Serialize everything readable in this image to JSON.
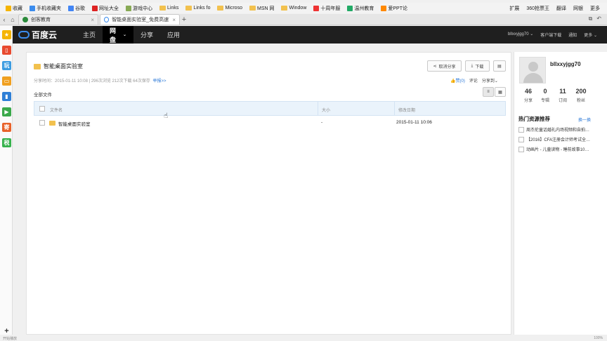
{
  "bookmarks": {
    "items": [
      "收藏",
      "手机收藏夹",
      "谷歌",
      "网址大全",
      "游戏中心",
      "Links",
      "Links fo",
      "Microso",
      "MSN 网",
      "Window",
      "十周年服",
      "温州教育",
      "爱PPT论"
    ],
    "right": [
      "扩展",
      "360抢票王",
      "翻译",
      "网银",
      "更多"
    ]
  },
  "tabs": [
    {
      "title": "创客教育"
    },
    {
      "title": "智能桌面实验室_免费高速下载"
    }
  ],
  "header": {
    "logo": "百度云",
    "nav": [
      "主页",
      "网盘",
      "分享",
      "应用"
    ],
    "user": "bllxxyjgg70",
    "links": [
      "客户端下载",
      "通知",
      "更多"
    ]
  },
  "share": {
    "title": "智能桌面实验室",
    "meta": "分享时间：2015-01-11 10:08 | 296次浏览 212次下载 64次保存",
    "report": "举报>>",
    "cancel_share": "取消分享",
    "download": "下载",
    "like": "赞(0)",
    "comment": "评论",
    "share_to": "分享到",
    "breadcrumb": "全部文件",
    "columns": {
      "name": "文件名",
      "size": "大小",
      "date": "修改日期"
    },
    "files": [
      {
        "name": "智能桌面实验室",
        "size": "-",
        "date": "2015-01-11 10:06"
      }
    ]
  },
  "profile": {
    "username": "bllxxyjgg70",
    "stats": [
      {
        "num": "46",
        "label": "分享"
      },
      {
        "num": "0",
        "label": "专辑"
      },
      {
        "num": "11",
        "label": "订阅"
      },
      {
        "num": "200",
        "label": "粉丝"
      }
    ],
    "hot_title": "热门资源推荐",
    "hot_more": "换一换",
    "hot_items": [
      "周杰伦童话婚礼内场视频和自拍…",
      "【2016】CFA注册会计师考试全…",
      "动画片 - 儿童读物 - 睡前故事10…"
    ]
  },
  "status": {
    "left": "开始播放",
    "right": "100%"
  },
  "colors": {
    "header_bg": "#1f1f1f",
    "accent": "#3b8ced",
    "table_head": "#eaf3fb",
    "folder": "#f2c14e"
  }
}
